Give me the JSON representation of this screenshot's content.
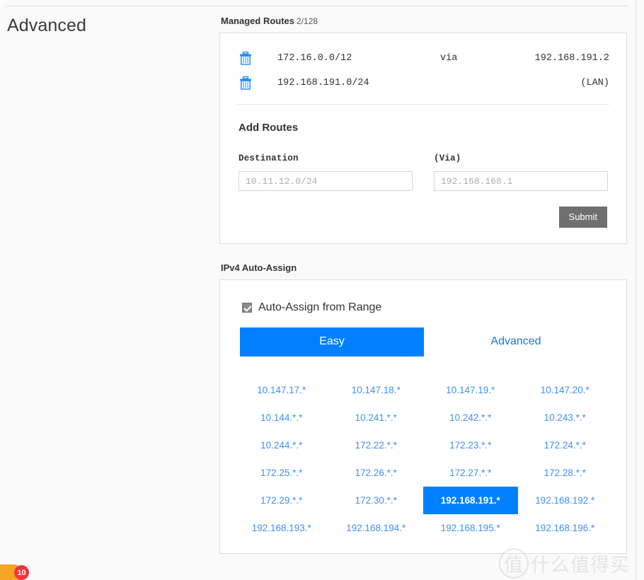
{
  "page": {
    "title": "Advanced"
  },
  "managed_routes": {
    "heading": "Managed Routes",
    "count": "2/128",
    "rows": [
      {
        "trash_icon": "trash-icon",
        "destination": "172.16.0.0/12",
        "via_label": "via",
        "gateway": "192.168.191.2"
      },
      {
        "trash_icon": "trash-icon",
        "destination": "192.168.191.0/24",
        "via_label": "",
        "gateway": "(LAN)"
      }
    ]
  },
  "add_routes": {
    "heading": "Add Routes",
    "destination": {
      "label": "Destination",
      "value": "",
      "placeholder": "10.11.12.0/24"
    },
    "via": {
      "label": "(Via)",
      "value": "",
      "placeholder": "192.168.168.1"
    },
    "submit_label": "Submit"
  },
  "ipv4_auto_assign": {
    "heading": "IPv4 Auto-Assign",
    "checkbox_label": "Auto-Assign from Range",
    "checkbox_checked": true,
    "tabs": [
      {
        "label": "Easy",
        "active": true
      },
      {
        "label": "Advanced",
        "active": false
      }
    ],
    "selected_range": "192.168.191.*",
    "ranges": [
      "10.147.17.*",
      "10.147.18.*",
      "10.147.19.*",
      "10.147.20.*",
      "10.144.*.*",
      "10.241.*.*",
      "10.242.*.*",
      "10.243.*.*",
      "10.244.*.*",
      "172.22.*.*",
      "172.23.*.*",
      "172.24.*.*",
      "172.25.*.*",
      "172.26.*.*",
      "172.27.*.*",
      "172.28.*.*",
      "172.29.*.*",
      "172.30.*.*",
      "192.168.191.*",
      "192.168.192.*",
      "192.168.193.*",
      "192.168.194.*",
      "192.168.195.*",
      "192.168.196.*"
    ]
  },
  "corner": {
    "badge_count": "10"
  },
  "watermark": {
    "ring_text": "值",
    "text": "什么值得买"
  },
  "colors": {
    "accent_blue": "#0080ff",
    "link_blue": "#3e91f5",
    "submit_gray": "#6f6f6f",
    "badge_red": "#f5333f",
    "badge_orange": "#f5a423"
  }
}
